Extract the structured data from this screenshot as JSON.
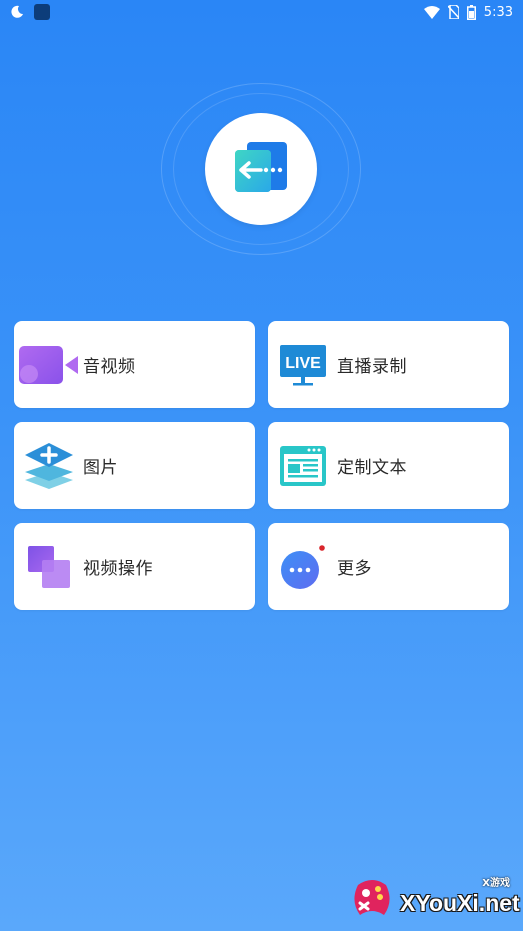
{
  "status_bar": {
    "time": "5:33",
    "left_icons": [
      "moon-icon",
      "square-notification-icon"
    ],
    "right_icons": [
      "wifi-icon",
      "no-sim-icon",
      "battery-icon"
    ]
  },
  "hero": {
    "logo_icon": "app-logo-icon"
  },
  "menu": {
    "items": [
      {
        "id": "audio-video",
        "label": "音视频",
        "icon": "video-camera-icon"
      },
      {
        "id": "live-record",
        "label": "直播录制",
        "icon": "live-tv-icon"
      },
      {
        "id": "images",
        "label": "图片",
        "icon": "image-layers-icon"
      },
      {
        "id": "custom-text",
        "label": "定制文本",
        "icon": "text-document-icon"
      },
      {
        "id": "video-ops",
        "label": "视频操作",
        "icon": "video-ops-icon"
      },
      {
        "id": "more",
        "label": "更多",
        "icon": "more-dots-icon"
      }
    ]
  },
  "watermark": {
    "text": "XYouXi.net",
    "tag": "X游戏"
  },
  "colors": {
    "background_top": "#2a86f6",
    "background_bottom": "#5aa8fb",
    "card": "#ffffff",
    "notification_dot": "#d9262c"
  }
}
